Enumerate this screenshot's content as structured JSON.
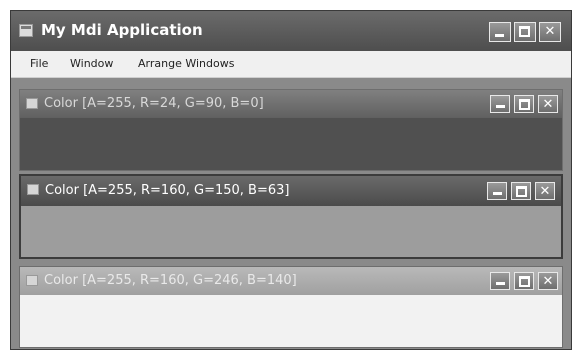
{
  "app": {
    "title": "My Mdi Application"
  },
  "menu": {
    "items": [
      "File",
      "Window",
      "Arrange Windows"
    ]
  },
  "children": [
    {
      "title": "Color [A=255, R=24, G=90, B=0]",
      "state": "inactive"
    },
    {
      "title": "Color [A=255, R=160, G=150, B=63]",
      "state": "active"
    },
    {
      "title": "Color [A=255, R=160, G=246, B=140]",
      "state": "inactive"
    }
  ],
  "controls": {
    "close_glyph": "✕"
  }
}
